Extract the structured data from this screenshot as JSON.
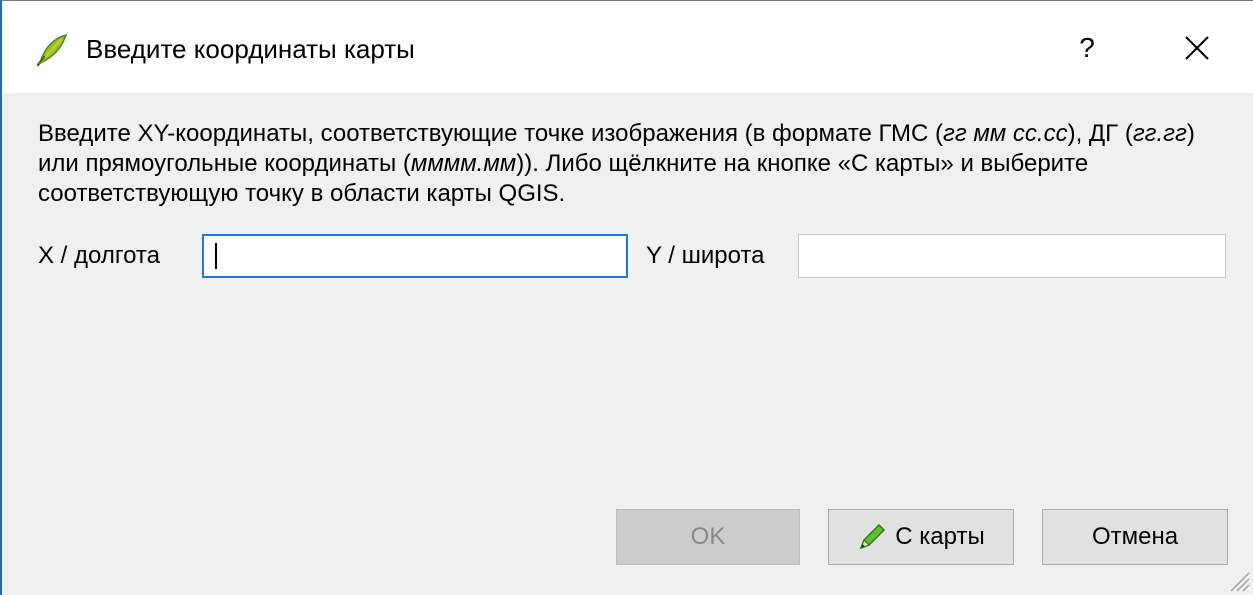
{
  "dialog": {
    "title": "Введите координаты карты",
    "help_label": "?",
    "description_parts": [
      "Введите XY-координаты, соответствующие точке изображения (в формате ГМС (",
      "гг мм сс.сс",
      "), ДГ (",
      "гг.гг",
      ") или прямоугольные координаты (",
      "мммм.мм",
      ")). Либо щёлкните на кнопке «С карты» и выберите соответствующую точку в области карты QGIS."
    ]
  },
  "fields": {
    "x_label": "X / долгота",
    "x_value": "",
    "y_label": "Y / широта",
    "y_value": ""
  },
  "buttons": {
    "ok_label": "OK",
    "from_map_label": "С карты",
    "cancel_label": "Отмена"
  },
  "icons": {
    "app": "qgis-icon",
    "close": "close-icon",
    "pencil": "pencil-icon",
    "grip": "resize-grip-icon"
  },
  "colors": {
    "focus_border": "#1e7ad6",
    "pencil_green": "#3c9a22",
    "window_border": "#1f6fb5"
  }
}
